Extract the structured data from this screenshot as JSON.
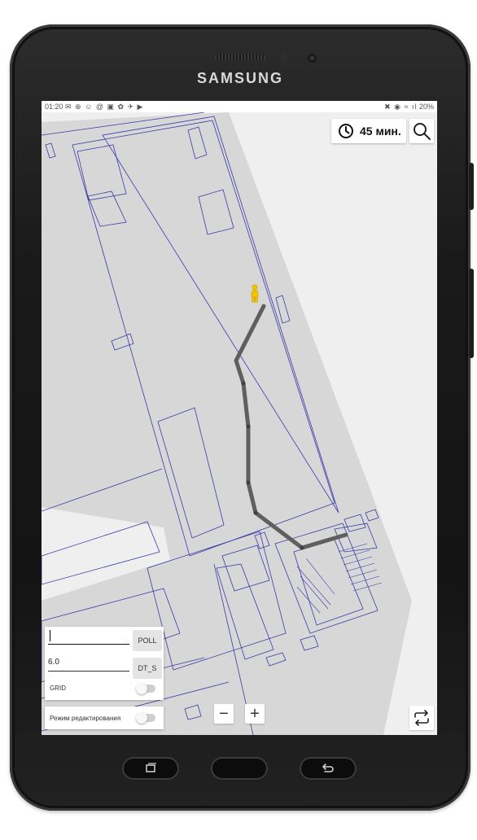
{
  "device": {
    "brand": "SAMSUNG"
  },
  "status_bar": {
    "time": "01:20",
    "notification_icons": "✉ ⊕ ☺ @ ▣ ✿ ✈ ▶",
    "system_icons": "✖ ◉ ≈ ıl",
    "battery": "20%"
  },
  "map": {
    "duration_label": "45 мин.",
    "icons": [
      "clock-icon",
      "search-icon",
      "person-marker-icon",
      "swap-route-icon"
    ]
  },
  "controls": {
    "text_input_value": "",
    "poll_button": "POLL",
    "number_input_value": "6.0",
    "dt_button": "DT_S",
    "grid_label": "GRID",
    "grid_enabled": false,
    "edit_mode_label": "Режим редактирования",
    "edit_mode_enabled": false,
    "zoom_out_label": "−",
    "zoom_in_label": "+"
  },
  "nav_bar": {
    "icons": [
      "recent-apps-icon",
      "home-button",
      "back-icon"
    ]
  }
}
